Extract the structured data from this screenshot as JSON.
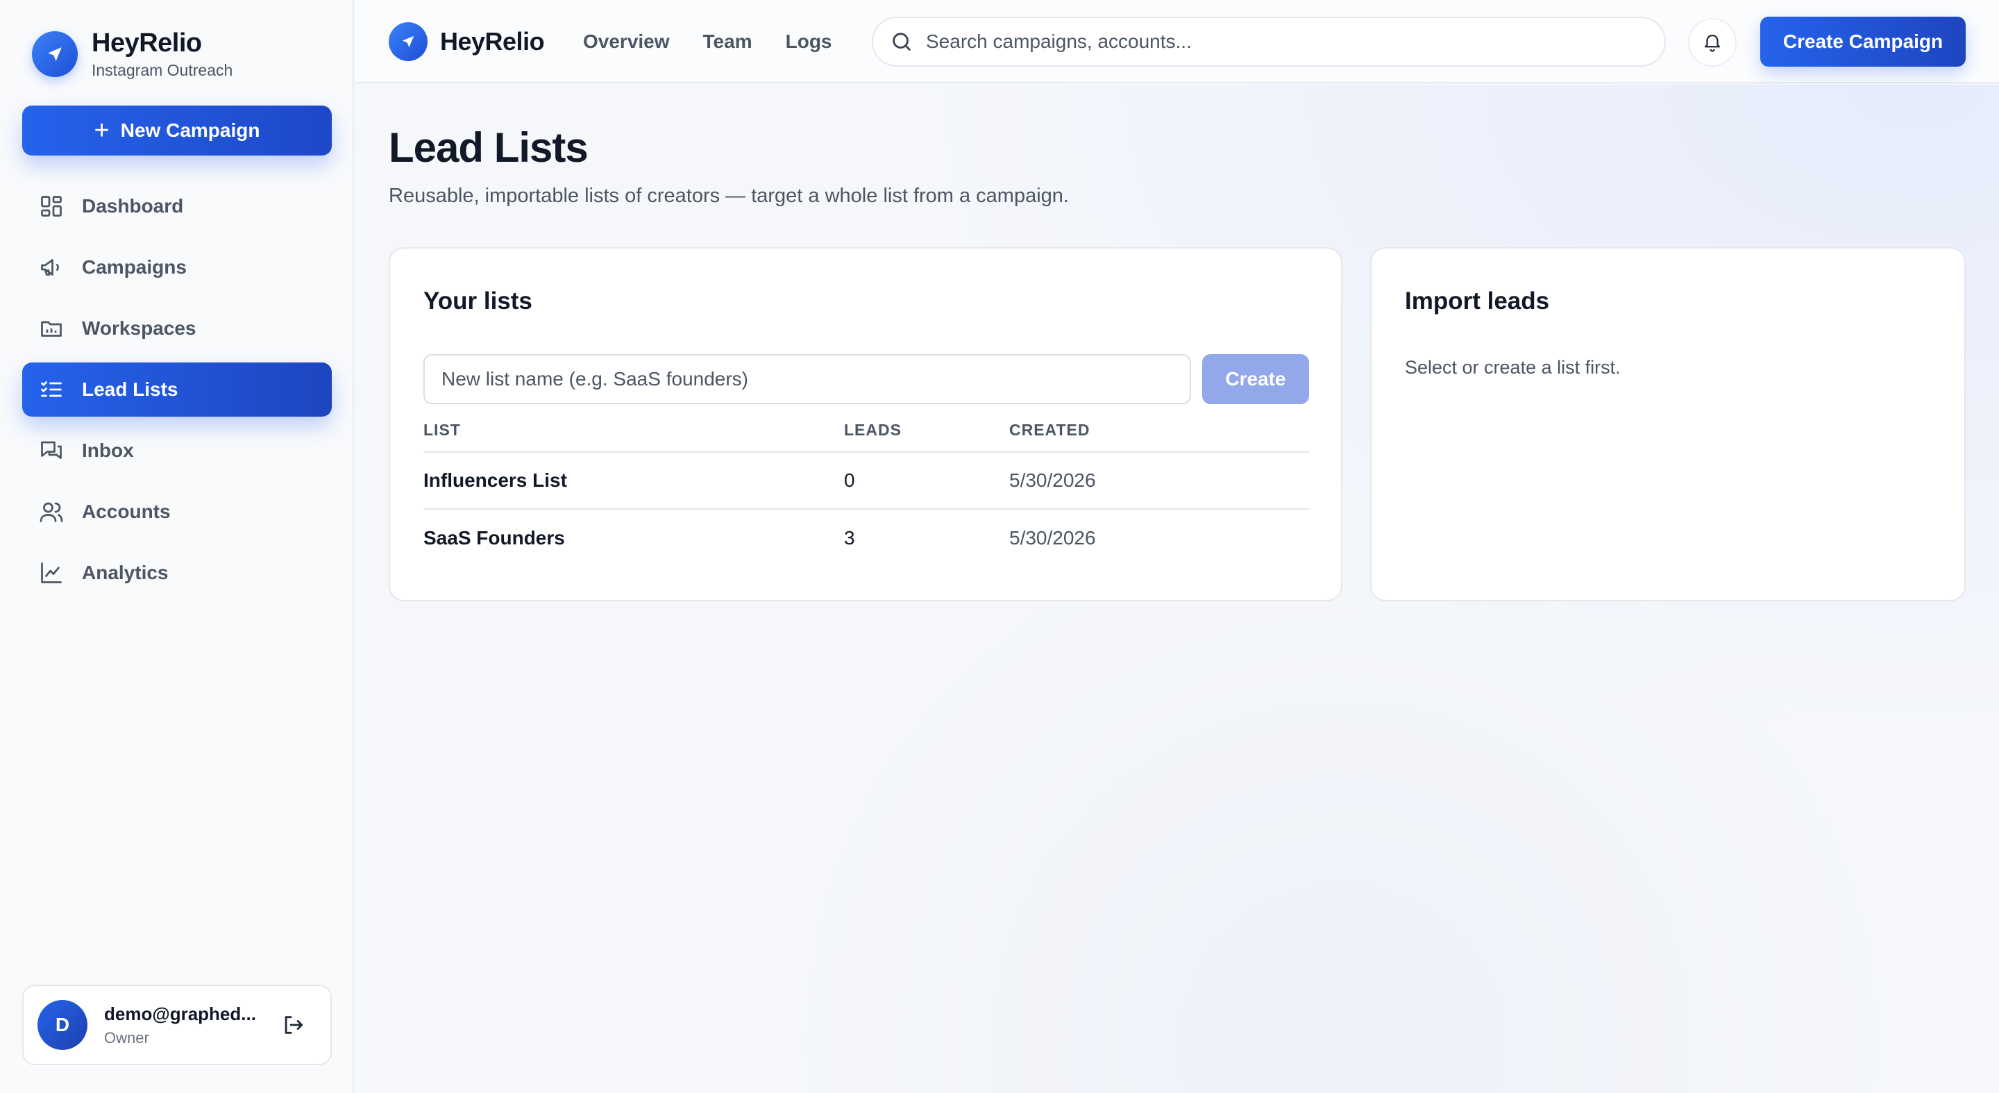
{
  "sidebar": {
    "brand_name": "HeyRelio",
    "brand_sub": "Instagram Outreach",
    "new_campaign_label": "New Campaign",
    "items": [
      {
        "label": "Dashboard",
        "icon": "dashboard-icon"
      },
      {
        "label": "Campaigns",
        "icon": "megaphone-icon"
      },
      {
        "label": "Workspaces",
        "icon": "folder-icon"
      },
      {
        "label": "Lead Lists",
        "icon": "list-check-icon",
        "active": true
      },
      {
        "label": "Inbox",
        "icon": "chat-icon"
      },
      {
        "label": "Accounts",
        "icon": "users-icon"
      },
      {
        "label": "Analytics",
        "icon": "chart-line-icon"
      }
    ],
    "user": {
      "initial": "D",
      "email": "demo@graphed...",
      "role": "Owner"
    }
  },
  "topbar": {
    "brand_name": "HeyRelio",
    "links": [
      "Overview",
      "Team",
      "Logs"
    ],
    "search_placeholder": "Search campaigns, accounts...",
    "create_campaign_label": "Create Campaign"
  },
  "page": {
    "title": "Lead Lists",
    "subtitle": "Reusable, importable lists of creators — target a whole list from a campaign."
  },
  "lists_card": {
    "title": "Your lists",
    "input_placeholder": "New list name (e.g. SaaS founders)",
    "create_label": "Create",
    "columns": [
      "LIST",
      "LEADS",
      "CREATED"
    ],
    "rows": [
      {
        "name": "Influencers List",
        "leads": "0",
        "created": "5/30/2026"
      },
      {
        "name": "SaaS Founders",
        "leads": "3",
        "created": "5/30/2026"
      }
    ]
  },
  "import_card": {
    "title": "Import leads",
    "message": "Select or create a list first."
  },
  "colors": {
    "accent": "#2563eb",
    "accent_dark": "#1e45c0",
    "create_disabled": "#93a7eb"
  }
}
